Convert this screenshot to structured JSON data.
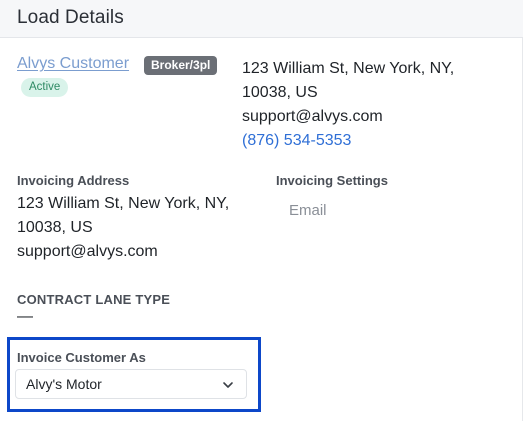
{
  "header": {
    "title": "Load Details"
  },
  "customer": {
    "name": "Alvys Customer",
    "type_badge": "Broker/3pl",
    "status_badge": "Active",
    "address_line1": "123 William St, New York, NY,",
    "address_line2": "10038, US",
    "email": "support@alvys.com",
    "phone": "(876) 534-5353"
  },
  "invoicing": {
    "address_label": "Invoicing Address",
    "address_line1": "123 William St, New York, NY,",
    "address_line2": "10038, US",
    "email": "support@alvys.com",
    "settings_label": "Invoicing Settings",
    "settings_value": "Email"
  },
  "contract_lane": {
    "label": "CONTRACT LANE TYPE",
    "value": "—"
  },
  "invoice_customer_as": {
    "label": "Invoice Customer As",
    "selected": "Alvy's Motor"
  },
  "colors": {
    "link": "#7b9dcf",
    "phone": "#2f6fd6",
    "broker_badge_bg": "#6b6f76",
    "active_badge_bg": "#d9f3ea",
    "active_badge_text": "#2e8a64",
    "highlight_border": "#0d47c9"
  },
  "icons": {
    "select_chevron": "chevron-down-icon"
  }
}
